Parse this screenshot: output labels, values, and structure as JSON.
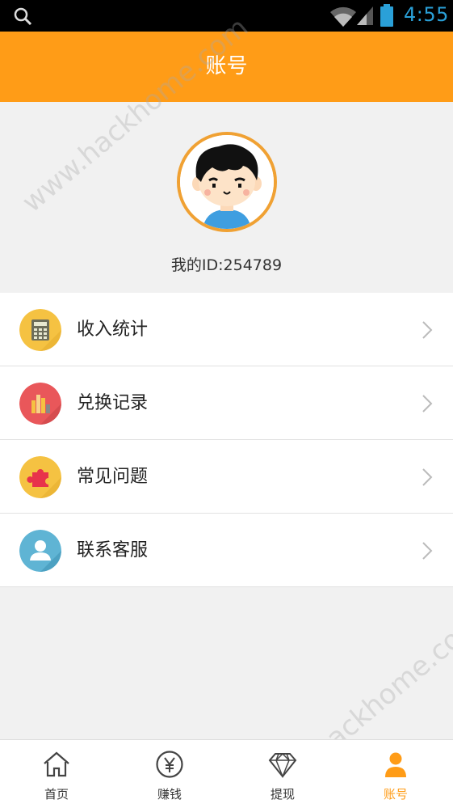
{
  "status_bar": {
    "time": "4:55",
    "icons": [
      "search-icon",
      "wifi-icon",
      "signal-icon",
      "battery-icon"
    ]
  },
  "header": {
    "title": "账号"
  },
  "profile": {
    "id_text": "我的ID:254789"
  },
  "menu": {
    "items": [
      {
        "label": "收入统计",
        "icon": "calculator-icon",
        "icon_color": "#f5c242"
      },
      {
        "label": "兑换记录",
        "icon": "bar-chart-icon",
        "icon_color": "#e9575a"
      },
      {
        "label": "常见问题",
        "icon": "puzzle-icon",
        "icon_color": "#f5c242"
      },
      {
        "label": "联系客服",
        "icon": "person-icon",
        "icon_color": "#5fb4d4"
      }
    ]
  },
  "watermark": {
    "text": "www.hackhome.com"
  },
  "tabs": [
    {
      "label": "首页",
      "icon": "home-icon",
      "active": false
    },
    {
      "label": "赚钱",
      "icon": "yen-coin-icon",
      "active": false
    },
    {
      "label": "提现",
      "icon": "diamond-icon",
      "active": false
    },
    {
      "label": "账号",
      "icon": "person-icon",
      "active": true
    }
  ],
  "colors": {
    "accent": "#ff9c17",
    "status_time": "#2aa0d8"
  }
}
